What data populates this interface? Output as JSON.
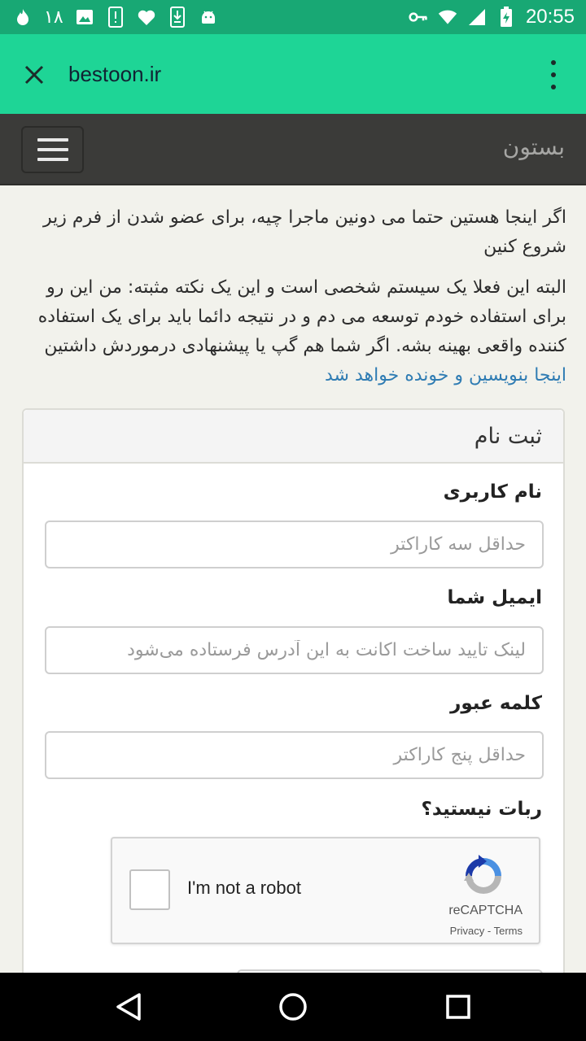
{
  "status_bar": {
    "notification_count": "۱۸",
    "time": "20:55",
    "icons": [
      "flame-icon",
      "image-icon",
      "alert-icon",
      "heart-icon",
      "download-icon",
      "android-icon",
      "key-icon",
      "wifi-icon",
      "signal-icon",
      "battery-charging-icon"
    ]
  },
  "browser": {
    "url": "bestoon.ir",
    "close_icon": "close-icon",
    "menu_icon": "more-vert-icon"
  },
  "navbar": {
    "brand": "بستون",
    "toggle_icon": "hamburger-icon"
  },
  "intro": {
    "paragraph1": "اگر اینجا هستین حتما می دونین ماجرا چیه، برای عضو شدن از فرم زیر شروع کنین",
    "paragraph2": "البته این فعلا یک سیستم شخصی است و این یک نکته مثبته: من این رو برای استفاده خودم توسعه می دم و در نتیجه دائما باید برای یک استفاده کننده واقعی بهینه بشه. اگر شما هم گپ یا پیشنهادی درموردش داشتین",
    "link": "اینجا بنویسین و خونده خواهد شد"
  },
  "form": {
    "title": "ثبت نام",
    "username": {
      "label": "نام کاربری",
      "placeholder": "حداقل سه کاراکتر",
      "value": ""
    },
    "email": {
      "label": "ایمیل شما",
      "placeholder": "لینک تایید ساخت اکانت به این آدرس فرستاده می‌شود",
      "value": ""
    },
    "password": {
      "label": "کلمه عبور",
      "placeholder": "حداقل پنج کاراکتر",
      "value": ""
    },
    "robot_label": "ربات نیستید؟",
    "recaptcha": {
      "text": "I'm not a robot",
      "brand": "reCAPTCHA",
      "privacy": "Privacy",
      "separator": " - ",
      "terms": "Terms",
      "checked": false
    }
  },
  "system_nav": {
    "icons": [
      "back-icon",
      "home-icon",
      "recents-icon"
    ]
  },
  "colors": {
    "status_bar": "#18a874",
    "tab_bar": "#1ed596",
    "navbar": "#3b3b39",
    "page_bg": "#f2f2ec",
    "link": "#2f7cb3"
  }
}
